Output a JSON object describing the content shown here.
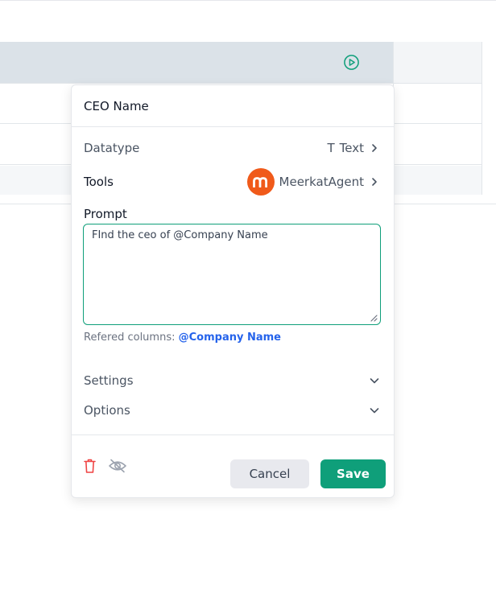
{
  "column_editor": {
    "column_name": "CEO Name",
    "datatype": {
      "label": "Datatype",
      "value": "Text",
      "type_glyph": "T"
    },
    "tools": {
      "label": "Tools",
      "agent_name": "MeerkatAgent",
      "agent_logo_letter": "m",
      "agent_logo_color": "#f05a1a"
    },
    "prompt": {
      "label": "Prompt",
      "value": "FInd the ceo of @Company Name"
    },
    "referred_columns": {
      "label": "Refered columns:",
      "column": "@Company Name"
    },
    "settings": {
      "label": "Settings"
    },
    "options": {
      "label": "Options"
    },
    "footer": {
      "delete_icon": "trash-icon",
      "hide_icon": "eye-off-icon",
      "cancel_label": "Cancel",
      "save_label": "Save"
    }
  },
  "colors": {
    "accent": "#0f9f7a",
    "link": "#2563eb",
    "danger": "#ef4444",
    "header_bg": "#dbe2e8"
  },
  "icons": {
    "run_column": "play-circle-icon"
  }
}
